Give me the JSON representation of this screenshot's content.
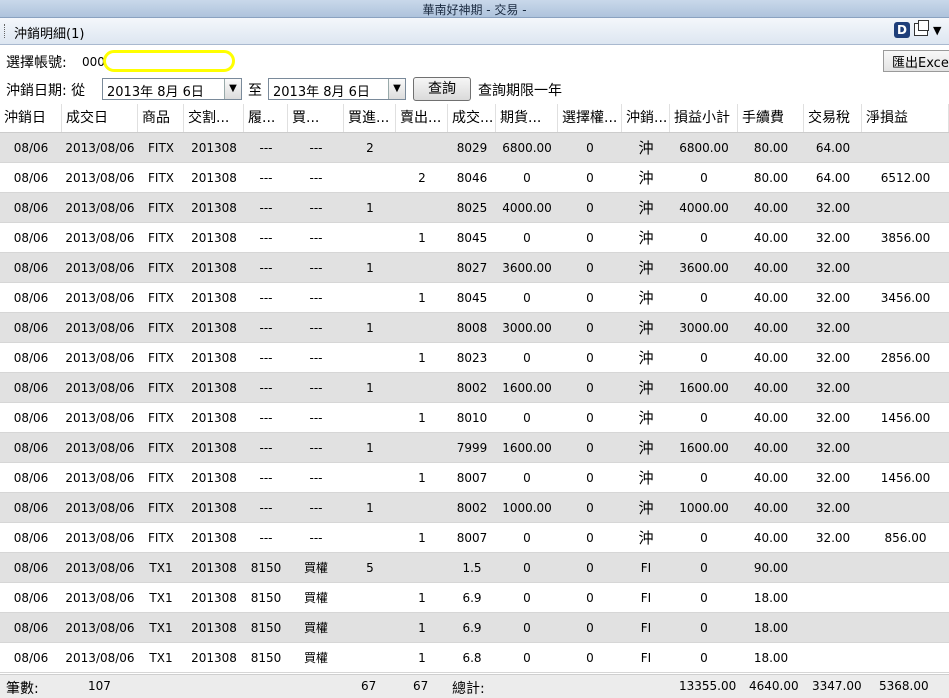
{
  "window": {
    "title": "華南好神期 - 交易 -"
  },
  "panel": {
    "title": "沖銷明細(1)",
    "d_icon": "D"
  },
  "account": {
    "label": "選擇帳號:",
    "value": "000-"
  },
  "date": {
    "label": "沖銷日期: 從",
    "from": "2013年  8月  6日",
    "to_label": "至",
    "to": "2013年  8月  6日",
    "query_label": "查詢",
    "limit_note": "查詢期限一年"
  },
  "export_label": "匯出Excel",
  "columns": [
    "沖銷日",
    "成交日",
    "商品",
    "交割...",
    "履...",
    "買...",
    "買進...",
    "賣出...",
    "成交...",
    "期貨...",
    "選擇權...",
    "沖銷...",
    "損益小計",
    "手續費",
    "交易稅",
    "淨損益"
  ],
  "rows": [
    [
      "08/06",
      "2013/08/06",
      "FITX",
      "201308",
      "---",
      "---",
      "2",
      "",
      "8029",
      "6800.00",
      "0",
      "沖",
      "6800.00",
      "80.00",
      "64.00",
      ""
    ],
    [
      "08/06",
      "2013/08/06",
      "FITX",
      "201308",
      "---",
      "---",
      "",
      "2",
      "8046",
      "0",
      "0",
      "沖",
      "0",
      "80.00",
      "64.00",
      "6512.00"
    ],
    [
      "08/06",
      "2013/08/06",
      "FITX",
      "201308",
      "---",
      "---",
      "1",
      "",
      "8025",
      "4000.00",
      "0",
      "沖",
      "4000.00",
      "40.00",
      "32.00",
      ""
    ],
    [
      "08/06",
      "2013/08/06",
      "FITX",
      "201308",
      "---",
      "---",
      "",
      "1",
      "8045",
      "0",
      "0",
      "沖",
      "0",
      "40.00",
      "32.00",
      "3856.00"
    ],
    [
      "08/06",
      "2013/08/06",
      "FITX",
      "201308",
      "---",
      "---",
      "1",
      "",
      "8027",
      "3600.00",
      "0",
      "沖",
      "3600.00",
      "40.00",
      "32.00",
      ""
    ],
    [
      "08/06",
      "2013/08/06",
      "FITX",
      "201308",
      "---",
      "---",
      "",
      "1",
      "8045",
      "0",
      "0",
      "沖",
      "0",
      "40.00",
      "32.00",
      "3456.00"
    ],
    [
      "08/06",
      "2013/08/06",
      "FITX",
      "201308",
      "---",
      "---",
      "1",
      "",
      "8008",
      "3000.00",
      "0",
      "沖",
      "3000.00",
      "40.00",
      "32.00",
      ""
    ],
    [
      "08/06",
      "2013/08/06",
      "FITX",
      "201308",
      "---",
      "---",
      "",
      "1",
      "8023",
      "0",
      "0",
      "沖",
      "0",
      "40.00",
      "32.00",
      "2856.00"
    ],
    [
      "08/06",
      "2013/08/06",
      "FITX",
      "201308",
      "---",
      "---",
      "1",
      "",
      "8002",
      "1600.00",
      "0",
      "沖",
      "1600.00",
      "40.00",
      "32.00",
      ""
    ],
    [
      "08/06",
      "2013/08/06",
      "FITX",
      "201308",
      "---",
      "---",
      "",
      "1",
      "8010",
      "0",
      "0",
      "沖",
      "0",
      "40.00",
      "32.00",
      "1456.00"
    ],
    [
      "08/06",
      "2013/08/06",
      "FITX",
      "201308",
      "---",
      "---",
      "1",
      "",
      "7999",
      "1600.00",
      "0",
      "沖",
      "1600.00",
      "40.00",
      "32.00",
      ""
    ],
    [
      "08/06",
      "2013/08/06",
      "FITX",
      "201308",
      "---",
      "---",
      "",
      "1",
      "8007",
      "0",
      "0",
      "沖",
      "0",
      "40.00",
      "32.00",
      "1456.00"
    ],
    [
      "08/06",
      "2013/08/06",
      "FITX",
      "201308",
      "---",
      "---",
      "1",
      "",
      "8002",
      "1000.00",
      "0",
      "沖",
      "1000.00",
      "40.00",
      "32.00",
      ""
    ],
    [
      "08/06",
      "2013/08/06",
      "FITX",
      "201308",
      "---",
      "---",
      "",
      "1",
      "8007",
      "0",
      "0",
      "沖",
      "0",
      "40.00",
      "32.00",
      "856.00"
    ],
    [
      "08/06",
      "2013/08/06",
      "TX1",
      "201308",
      "8150",
      "買權",
      "5",
      "",
      "1.5",
      "0",
      "0",
      "FI",
      "0",
      "90.00",
      "",
      ""
    ],
    [
      "08/06",
      "2013/08/06",
      "TX1",
      "201308",
      "8150",
      "買權",
      "",
      "1",
      "6.9",
      "0",
      "0",
      "FI",
      "0",
      "18.00",
      "",
      ""
    ],
    [
      "08/06",
      "2013/08/06",
      "TX1",
      "201308",
      "8150",
      "買權",
      "",
      "1",
      "6.9",
      "0",
      "0",
      "FI",
      "0",
      "18.00",
      "",
      ""
    ],
    [
      "08/06",
      "2013/08/06",
      "TX1",
      "201308",
      "8150",
      "買權",
      "",
      "1",
      "6.8",
      "0",
      "0",
      "FI",
      "0",
      "18.00",
      "",
      ""
    ]
  ],
  "footer": {
    "count_label": "筆數:",
    "count": "107",
    "buy_total": "67",
    "sell_total": "67",
    "total_label": "總計:",
    "pnl_total": "13355.00",
    "fee_total": "4640.00",
    "tax_total": "3347.00",
    "net_total": "5368.00"
  }
}
